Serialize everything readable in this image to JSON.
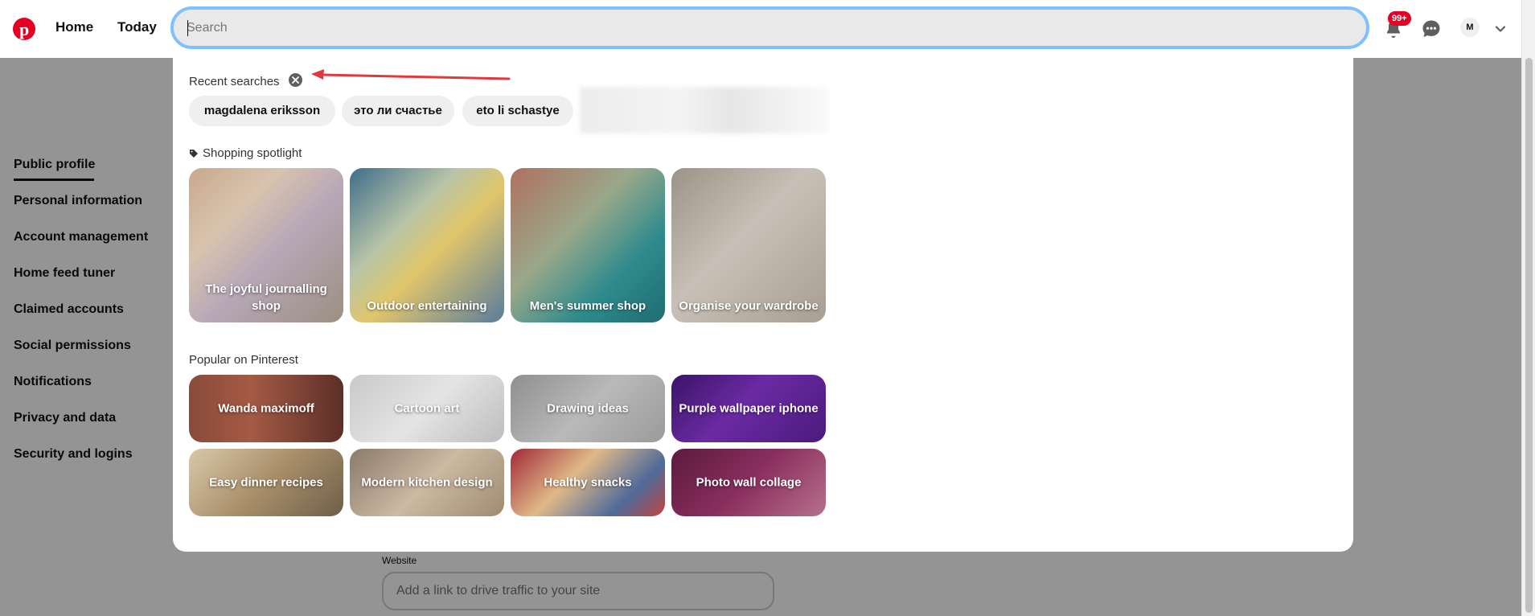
{
  "header": {
    "nav_home": "Home",
    "nav_today": "Today",
    "search_placeholder": "Search",
    "notification_count": "99+",
    "avatar_initial": "M"
  },
  "sidebar": {
    "items": [
      {
        "label": "Public profile",
        "active": true
      },
      {
        "label": "Personal information"
      },
      {
        "label": "Account management"
      },
      {
        "label": "Home feed tuner"
      },
      {
        "label": "Claimed accounts"
      },
      {
        "label": "Social permissions"
      },
      {
        "label": "Notifications"
      },
      {
        "label": "Privacy and data"
      },
      {
        "label": "Security and logins"
      }
    ]
  },
  "profile_form": {
    "website_label": "Website",
    "website_placeholder": "Add a link to drive traffic to your site"
  },
  "dropdown": {
    "recent_title": "Recent searches",
    "recent_chips": [
      "magdalena eriksson",
      "это ли счастье",
      "eto li schastye"
    ],
    "spotlight_title": "Shopping spotlight",
    "spotlight_tiles": [
      "The joyful journalling shop",
      "Outdoor entertaining",
      "Men's summer shop",
      "Organise your wardrobe"
    ],
    "popular_title": "Popular on Pinterest",
    "popular_tiles": [
      "Wanda maximoff",
      "Cartoon art",
      "Drawing ideas",
      "Purple wallpaper iphone",
      "Easy dinner recipes",
      "Modern kitchen design",
      "Healthy snacks",
      "Photo wall collage"
    ]
  },
  "colors": {
    "brand_red": "#e60023",
    "search_focus_ring": "#7fc1ff",
    "annotation_arrow": "#e0393b"
  },
  "icons": [
    "pinterest-logo-icon",
    "bell-icon",
    "chat-icon",
    "chevron-down-icon",
    "clear-x-icon",
    "tag-icon"
  ]
}
